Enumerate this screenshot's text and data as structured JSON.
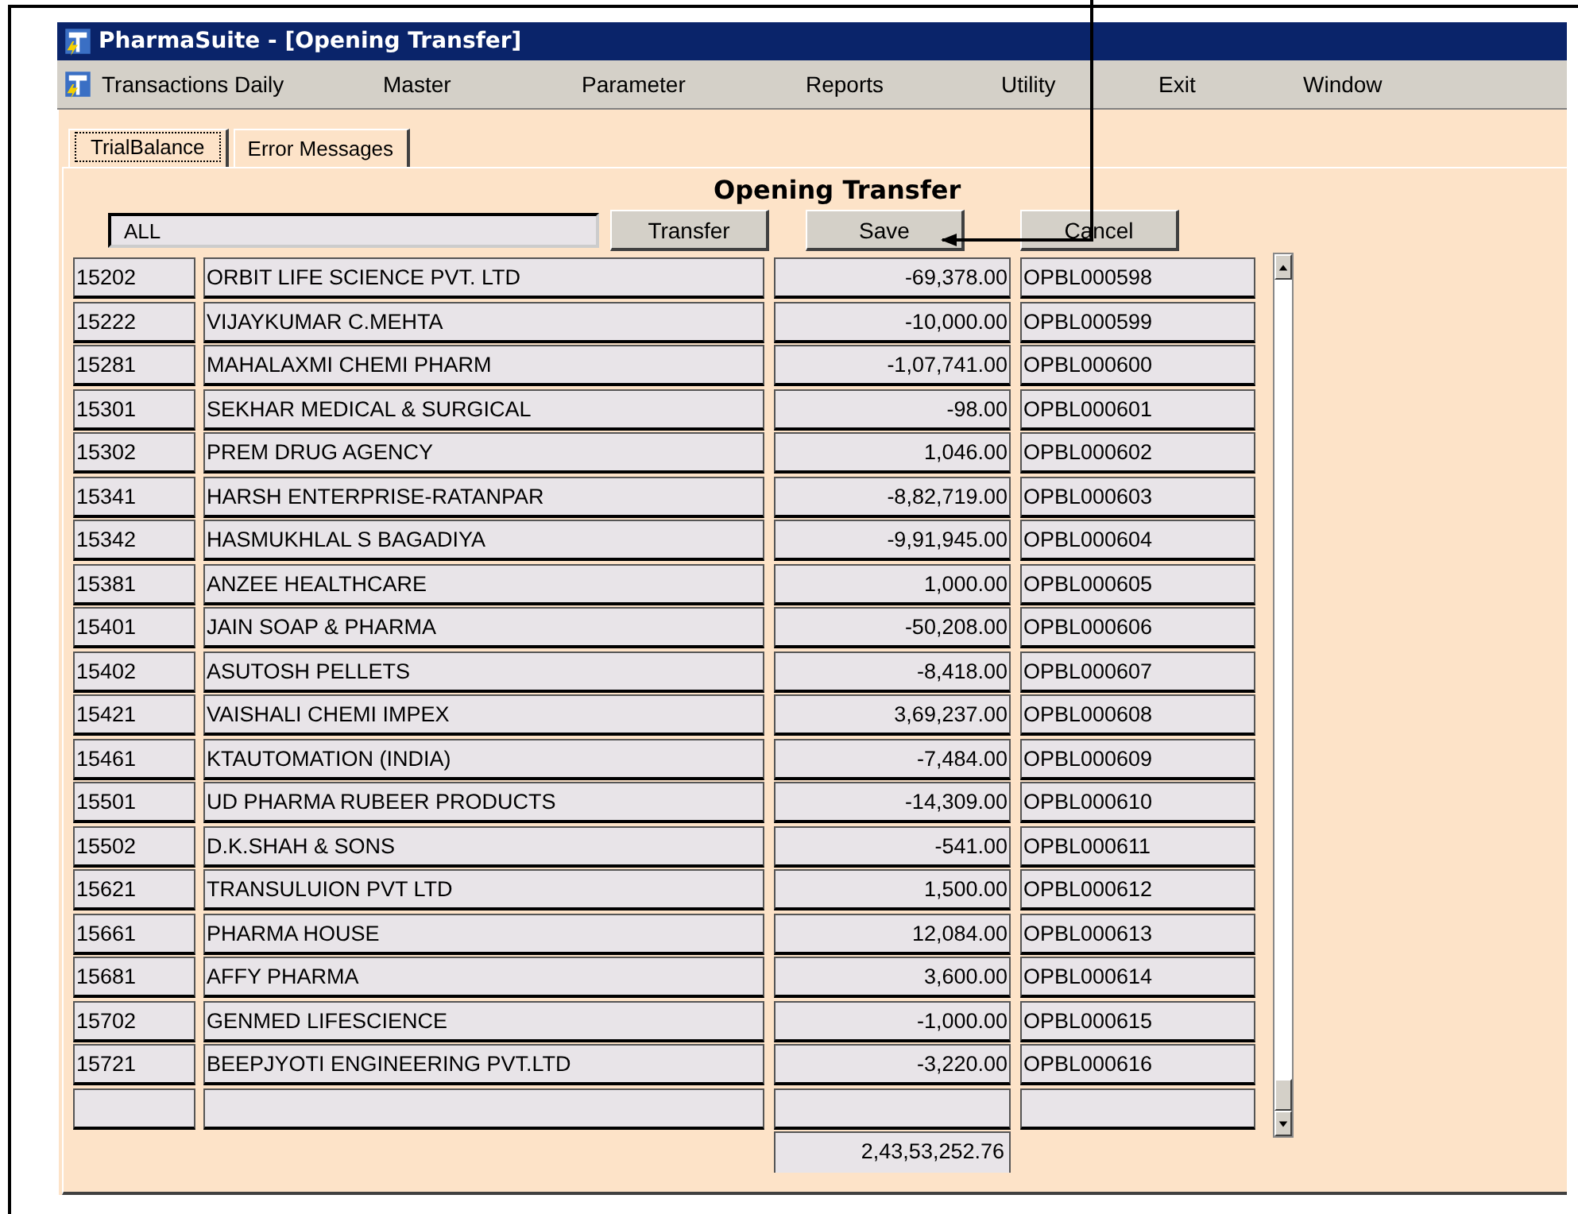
{
  "window": {
    "title": "PharmaSuite - [Opening Transfer]"
  },
  "menu": [
    "Transactions Daily",
    "Master",
    "Parameter",
    "Reports",
    "Utility",
    "Exit",
    "Window"
  ],
  "tabs": [
    {
      "label": "TrialBalance",
      "selected": true
    },
    {
      "label": "Error Messages",
      "selected": false
    }
  ],
  "heading": "Opening Transfer",
  "filter": {
    "value": "ALL"
  },
  "buttons": [
    "Transfer",
    "Save",
    "Cancel"
  ],
  "rows": [
    {
      "code": "15202",
      "name": "ORBIT LIFE SCIENCE PVT. LTD",
      "amount": "-69,378.00",
      "ref": "OPBL000598"
    },
    {
      "code": "15222",
      "name": "VIJAYKUMAR C.MEHTA",
      "amount": "-10,000.00",
      "ref": "OPBL000599"
    },
    {
      "code": "15281",
      "name": "MAHALAXMI CHEMI PHARM",
      "amount": "-1,07,741.00",
      "ref": "OPBL000600"
    },
    {
      "code": "15301",
      "name": "SEKHAR MEDICAL & SURGICAL",
      "amount": "-98.00",
      "ref": "OPBL000601"
    },
    {
      "code": "15302",
      "name": "PREM DRUG AGENCY",
      "amount": "1,046.00",
      "ref": "OPBL000602"
    },
    {
      "code": "15341",
      "name": "HARSH ENTERPRISE-RATANPAR",
      "amount": "-8,82,719.00",
      "ref": "OPBL000603"
    },
    {
      "code": "15342",
      "name": "HASMUKHLAL S BAGADIYA",
      "amount": "-9,91,945.00",
      "ref": "OPBL000604"
    },
    {
      "code": "15381",
      "name": "ANZEE HEALTHCARE",
      "amount": "1,000.00",
      "ref": "OPBL000605"
    },
    {
      "code": "15401",
      "name": "JAIN SOAP & PHARMA",
      "amount": "-50,208.00",
      "ref": "OPBL000606"
    },
    {
      "code": "15402",
      "name": "ASUTOSH PELLETS",
      "amount": "-8,418.00",
      "ref": "OPBL000607"
    },
    {
      "code": "15421",
      "name": "VAISHALI CHEMI IMPEX",
      "amount": "3,69,237.00",
      "ref": "OPBL000608"
    },
    {
      "code": "15461",
      "name": "KTAUTOMATION (INDIA)",
      "amount": "-7,484.00",
      "ref": "OPBL000609"
    },
    {
      "code": "15501",
      "name": "UD PHARMA RUBEER PRODUCTS",
      "amount": "-14,309.00",
      "ref": "OPBL000610"
    },
    {
      "code": "15502",
      "name": "D.K.SHAH & SONS",
      "amount": "-541.00",
      "ref": "OPBL000611"
    },
    {
      "code": "15621",
      "name": "TRANSULUION PVT LTD",
      "amount": "1,500.00",
      "ref": "OPBL000612"
    },
    {
      "code": "15661",
      "name": "PHARMA HOUSE",
      "amount": "12,084.00",
      "ref": "OPBL000613"
    },
    {
      "code": "15681",
      "name": "AFFY PHARMA",
      "amount": "3,600.00",
      "ref": "OPBL000614"
    },
    {
      "code": "15702",
      "name": "GENMED LIFESCIENCE",
      "amount": "-1,000.00",
      "ref": "OPBL000615"
    },
    {
      "code": "15721",
      "name": "BEEPJYOTI ENGINEERING PVT.LTD",
      "amount": "-3,220.00",
      "ref": "OPBL000616"
    }
  ],
  "total": "2,43,53,252.76"
}
